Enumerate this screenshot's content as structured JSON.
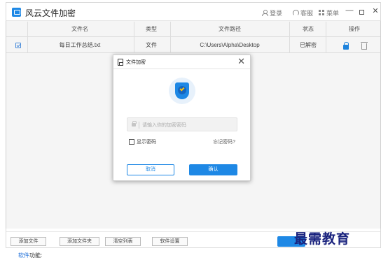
{
  "app": {
    "title": "风云文件加密"
  },
  "titlebar": {
    "login": "登录",
    "service": "客服",
    "menu": "菜单",
    "minimize": "—",
    "close": "✕"
  },
  "table": {
    "headers": [
      "文件名",
      "类型",
      "文件路径",
      "状态",
      "操作"
    ],
    "rows": [
      {
        "name": "每日工作总结.txt",
        "type": "文件",
        "path": "C:\\Users\\Alpha\\Desktop",
        "status": "已解密",
        "checked": true
      }
    ]
  },
  "toolbar": {
    "buttons": [
      "添加文件",
      "添加文件夹",
      "清空列表",
      "软件设置"
    ]
  },
  "dialog": {
    "title": "文件加密",
    "close": "✕",
    "password_placeholder": "请输入你的加密密码",
    "show_password": "显示密码",
    "forgot_password": "忘记密码?",
    "cancel": "取消",
    "confirm": "确认"
  },
  "watermark": "最需教育",
  "footer": {
    "link": "软件",
    "text": "功能:"
  },
  "colors": {
    "accent": "#1e88e5",
    "watermark": "#1a237e"
  }
}
